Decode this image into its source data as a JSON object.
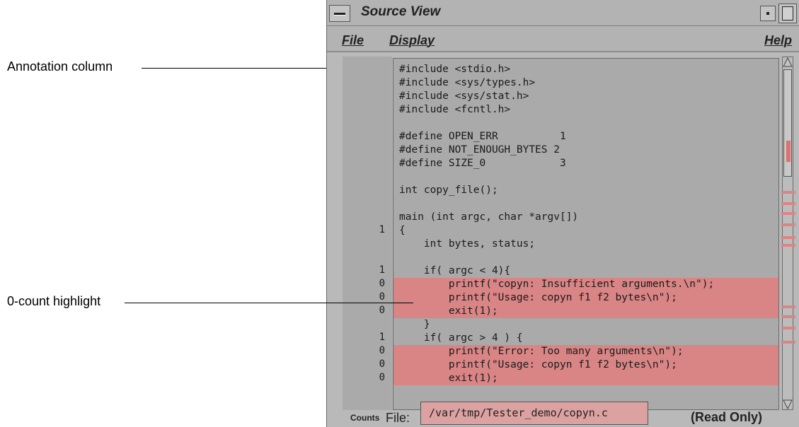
{
  "callouts": {
    "annotation_column": "Annotation column",
    "zero_count": "0-count highlight"
  },
  "window": {
    "title": "Source View"
  },
  "menu": {
    "file": "File",
    "display": "Display",
    "help": "Help"
  },
  "code": [
    {
      "text": "#include <stdio.h>",
      "count": "",
      "zero": false
    },
    {
      "text": "#include <sys/types.h>",
      "count": "",
      "zero": false
    },
    {
      "text": "#include <sys/stat.h>",
      "count": "",
      "zero": false
    },
    {
      "text": "#include <fcntl.h>",
      "count": "",
      "zero": false
    },
    {
      "text": "",
      "count": "",
      "zero": false
    },
    {
      "text": "#define OPEN_ERR          1",
      "count": "",
      "zero": false
    },
    {
      "text": "#define NOT_ENOUGH_BYTES 2",
      "count": "",
      "zero": false
    },
    {
      "text": "#define SIZE_0            3",
      "count": "",
      "zero": false
    },
    {
      "text": "",
      "count": "",
      "zero": false
    },
    {
      "text": "int copy_file();",
      "count": "",
      "zero": false
    },
    {
      "text": "",
      "count": "",
      "zero": false
    },
    {
      "text": "main (int argc, char *argv[])",
      "count": "",
      "zero": false
    },
    {
      "text": "{",
      "count": "1",
      "zero": false
    },
    {
      "text": "    int bytes, status;",
      "count": "",
      "zero": false
    },
    {
      "text": "",
      "count": "",
      "zero": false
    },
    {
      "text": "    if( argc < 4){",
      "count": "1",
      "zero": false
    },
    {
      "text": "        printf(\"copyn: Insufficient arguments.\\n\");",
      "count": "0",
      "zero": true
    },
    {
      "text": "        printf(\"Usage: copyn f1 f2 bytes\\n\");",
      "count": "0",
      "zero": true
    },
    {
      "text": "        exit(1);",
      "count": "0",
      "zero": true
    },
    {
      "text": "    }",
      "count": "",
      "zero": false
    },
    {
      "text": "    if( argc > 4 ) {",
      "count": "1",
      "zero": false
    },
    {
      "text": "        printf(\"Error: Too many arguments\\n\");",
      "count": "0",
      "zero": true
    },
    {
      "text": "        printf(\"Usage: copyn f1 f2 bytes\\n\");",
      "count": "0",
      "zero": true
    },
    {
      "text": "        exit(1);",
      "count": "0",
      "zero": true
    }
  ],
  "footer": {
    "counts_label": "Counts",
    "file_label": "File:",
    "file_path": "/var/tmp/Tester_demo/copyn.c",
    "read_only": "(Read Only)"
  },
  "colors": {
    "zero_count_highlight": "#d98585",
    "file_field": "#dca2a2"
  }
}
